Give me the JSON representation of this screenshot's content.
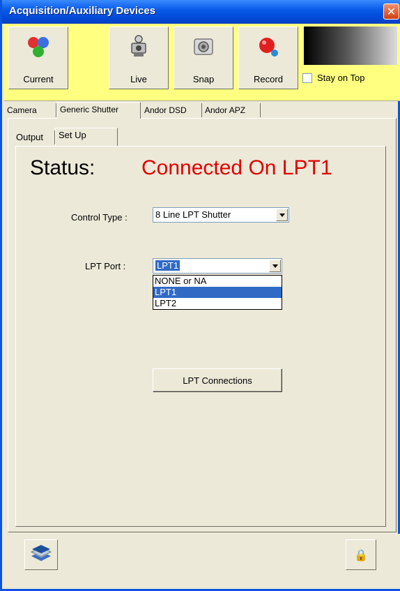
{
  "window": {
    "title": "Acquisition/Auxiliary Devices",
    "close_glyph": "✕"
  },
  "toolbar": {
    "buttons": [
      {
        "label": "Current",
        "icon": "molecule-icon"
      },
      {
        "label": "Live",
        "icon": "video-camera-icon"
      },
      {
        "label": "Snap",
        "icon": "camera-icon"
      },
      {
        "label": "Record",
        "icon": "record-icon"
      }
    ],
    "stay_on_top": {
      "label": "Stay on Top",
      "checked": false
    }
  },
  "device_tabs": [
    "Camera",
    "Generic Shutter",
    "Andor DSD",
    "Andor APZ"
  ],
  "device_tab_active": "Generic Shutter",
  "sub_tabs": [
    "Output",
    "Set Up"
  ],
  "sub_tab_active": "Set Up",
  "status": {
    "label": "Status:",
    "value": "Connected On LPT1",
    "value_color": "#e00000"
  },
  "control_type": {
    "label": "Control Type :",
    "value": "8 Line LPT Shutter"
  },
  "lpt_port": {
    "label": "LPT Port :",
    "value": "LPT1",
    "options": [
      "NONE or NA",
      "LPT1",
      "LPT2"
    ],
    "selected": "LPT1"
  },
  "lpt_connections_button": "LPT Connections",
  "bottom": {
    "left_icon": "layers-icon",
    "right_icon": "lock-icon",
    "lock_glyph": "🔒"
  },
  "colors": {
    "title_bar": "#0a5be8",
    "toolbar_bg": "#ffff80",
    "selection": "#316ac5",
    "status_red": "#e00000"
  }
}
